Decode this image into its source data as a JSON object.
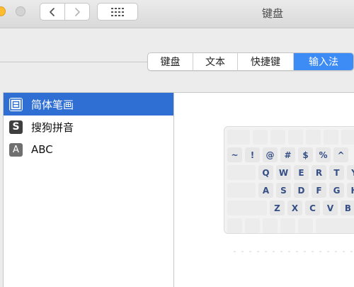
{
  "window": {
    "title": "键盘"
  },
  "tabs": [
    {
      "label": "键盘",
      "active": false
    },
    {
      "label": "文本",
      "active": false
    },
    {
      "label": "快捷键",
      "active": false
    },
    {
      "label": "输入法",
      "active": true
    }
  ],
  "input_sources": [
    {
      "label": "简体笔画",
      "icon": "bihua-icon",
      "selected": true
    },
    {
      "label": "搜狗拼音",
      "icon": "sogou-icon",
      "icon_glyph": "S",
      "selected": false
    },
    {
      "label": "ABC",
      "icon": "abc-icon",
      "icon_glyph": "A",
      "selected": false
    }
  ],
  "keyboard": {
    "row_symbols": [
      "~",
      "!",
      "@",
      "#",
      "$",
      "%",
      "^"
    ],
    "row_qwerty": [
      "Q",
      "W",
      "E",
      "R",
      "T",
      "Y"
    ],
    "row_asdf": [
      "A",
      "S",
      "D",
      "F",
      "G",
      "H"
    ],
    "row_zxcv": [
      "Z",
      "X",
      "C",
      "V",
      "B"
    ]
  },
  "colors": {
    "selected_row": "#2f6fd3",
    "active_tab": "#3d8bf5",
    "key_label": "#354f86"
  }
}
